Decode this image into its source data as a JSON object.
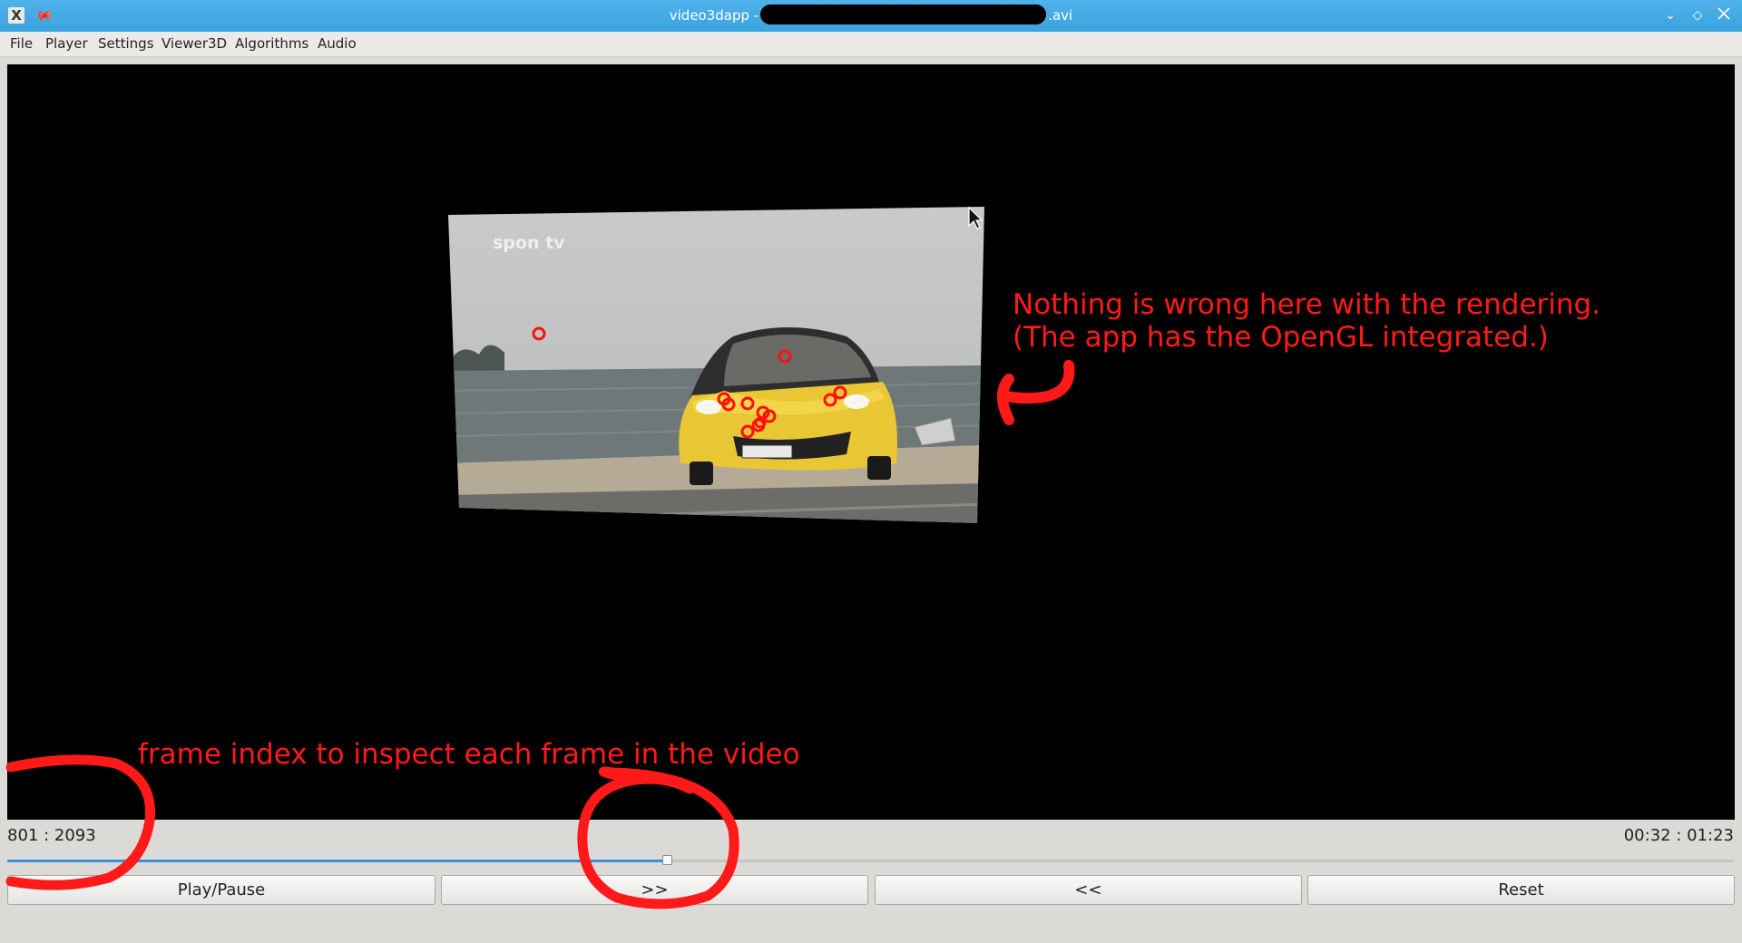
{
  "window": {
    "title_prefix": "video3dapp -",
    "title_suffix": ".avi"
  },
  "menu": [
    {
      "label": "File"
    },
    {
      "label": "Player"
    },
    {
      "label": "Settings"
    },
    {
      "label": "Viewer3D"
    },
    {
      "label": "Algorithms"
    },
    {
      "label": "Audio"
    }
  ],
  "video": {
    "watermark": "spon tv"
  },
  "status": {
    "frame_counter": "801 : 2093",
    "time_counter": "00:32 : 01:23",
    "slider_progress": 0.382
  },
  "controls": {
    "play_pause_label": "Play/Pause",
    "forward_label": ">>",
    "back_label": "<<",
    "reset_label": "Reset"
  },
  "annotations": {
    "rendering_note_line1": "Nothing is wrong here with the rendering.",
    "rendering_note_line2": "(The app has the OpenGL integrated.)",
    "frame_index_note": "frame index to inspect each frame in the video"
  },
  "colors": {
    "annotation": "#ff1a1a",
    "slider_fill": "#3b8ed8",
    "titlebar": "#3ba3df",
    "car_body": "#e8c634"
  }
}
